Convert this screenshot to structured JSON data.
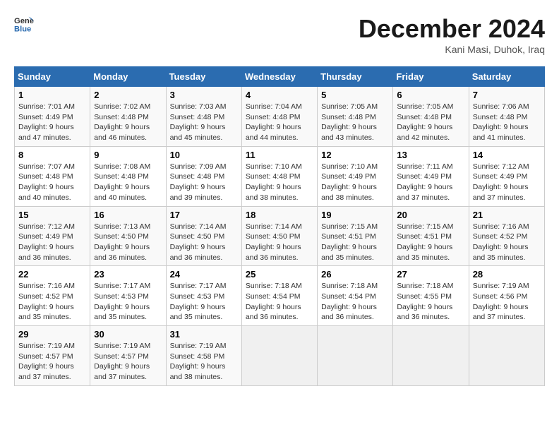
{
  "header": {
    "logo_line1": "General",
    "logo_line2": "Blue",
    "month": "December 2024",
    "location": "Kani Masi, Duhok, Iraq"
  },
  "days_of_week": [
    "Sunday",
    "Monday",
    "Tuesday",
    "Wednesday",
    "Thursday",
    "Friday",
    "Saturday"
  ],
  "weeks": [
    [
      {
        "day": "1",
        "sunrise": "7:01 AM",
        "sunset": "4:49 PM",
        "daylight": "9 hours and 47 minutes."
      },
      {
        "day": "2",
        "sunrise": "7:02 AM",
        "sunset": "4:48 PM",
        "daylight": "9 hours and 46 minutes."
      },
      {
        "day": "3",
        "sunrise": "7:03 AM",
        "sunset": "4:48 PM",
        "daylight": "9 hours and 45 minutes."
      },
      {
        "day": "4",
        "sunrise": "7:04 AM",
        "sunset": "4:48 PM",
        "daylight": "9 hours and 44 minutes."
      },
      {
        "day": "5",
        "sunrise": "7:05 AM",
        "sunset": "4:48 PM",
        "daylight": "9 hours and 43 minutes."
      },
      {
        "day": "6",
        "sunrise": "7:05 AM",
        "sunset": "4:48 PM",
        "daylight": "9 hours and 42 minutes."
      },
      {
        "day": "7",
        "sunrise": "7:06 AM",
        "sunset": "4:48 PM",
        "daylight": "9 hours and 41 minutes."
      }
    ],
    [
      {
        "day": "8",
        "sunrise": "7:07 AM",
        "sunset": "4:48 PM",
        "daylight": "9 hours and 40 minutes."
      },
      {
        "day": "9",
        "sunrise": "7:08 AM",
        "sunset": "4:48 PM",
        "daylight": "9 hours and 40 minutes."
      },
      {
        "day": "10",
        "sunrise": "7:09 AM",
        "sunset": "4:48 PM",
        "daylight": "9 hours and 39 minutes."
      },
      {
        "day": "11",
        "sunrise": "7:10 AM",
        "sunset": "4:48 PM",
        "daylight": "9 hours and 38 minutes."
      },
      {
        "day": "12",
        "sunrise": "7:10 AM",
        "sunset": "4:49 PM",
        "daylight": "9 hours and 38 minutes."
      },
      {
        "day": "13",
        "sunrise": "7:11 AM",
        "sunset": "4:49 PM",
        "daylight": "9 hours and 37 minutes."
      },
      {
        "day": "14",
        "sunrise": "7:12 AM",
        "sunset": "4:49 PM",
        "daylight": "9 hours and 37 minutes."
      }
    ],
    [
      {
        "day": "15",
        "sunrise": "7:12 AM",
        "sunset": "4:49 PM",
        "daylight": "9 hours and 36 minutes."
      },
      {
        "day": "16",
        "sunrise": "7:13 AM",
        "sunset": "4:50 PM",
        "daylight": "9 hours and 36 minutes."
      },
      {
        "day": "17",
        "sunrise": "7:14 AM",
        "sunset": "4:50 PM",
        "daylight": "9 hours and 36 minutes."
      },
      {
        "day": "18",
        "sunrise": "7:14 AM",
        "sunset": "4:50 PM",
        "daylight": "9 hours and 36 minutes."
      },
      {
        "day": "19",
        "sunrise": "7:15 AM",
        "sunset": "4:51 PM",
        "daylight": "9 hours and 35 minutes."
      },
      {
        "day": "20",
        "sunrise": "7:15 AM",
        "sunset": "4:51 PM",
        "daylight": "9 hours and 35 minutes."
      },
      {
        "day": "21",
        "sunrise": "7:16 AM",
        "sunset": "4:52 PM",
        "daylight": "9 hours and 35 minutes."
      }
    ],
    [
      {
        "day": "22",
        "sunrise": "7:16 AM",
        "sunset": "4:52 PM",
        "daylight": "9 hours and 35 minutes."
      },
      {
        "day": "23",
        "sunrise": "7:17 AM",
        "sunset": "4:53 PM",
        "daylight": "9 hours and 35 minutes."
      },
      {
        "day": "24",
        "sunrise": "7:17 AM",
        "sunset": "4:53 PM",
        "daylight": "9 hours and 35 minutes."
      },
      {
        "day": "25",
        "sunrise": "7:18 AM",
        "sunset": "4:54 PM",
        "daylight": "9 hours and 36 minutes."
      },
      {
        "day": "26",
        "sunrise": "7:18 AM",
        "sunset": "4:54 PM",
        "daylight": "9 hours and 36 minutes."
      },
      {
        "day": "27",
        "sunrise": "7:18 AM",
        "sunset": "4:55 PM",
        "daylight": "9 hours and 36 minutes."
      },
      {
        "day": "28",
        "sunrise": "7:19 AM",
        "sunset": "4:56 PM",
        "daylight": "9 hours and 37 minutes."
      }
    ],
    [
      {
        "day": "29",
        "sunrise": "7:19 AM",
        "sunset": "4:57 PM",
        "daylight": "9 hours and 37 minutes."
      },
      {
        "day": "30",
        "sunrise": "7:19 AM",
        "sunset": "4:57 PM",
        "daylight": "9 hours and 37 minutes."
      },
      {
        "day": "31",
        "sunrise": "7:19 AM",
        "sunset": "4:58 PM",
        "daylight": "9 hours and 38 minutes."
      },
      null,
      null,
      null,
      null
    ]
  ]
}
